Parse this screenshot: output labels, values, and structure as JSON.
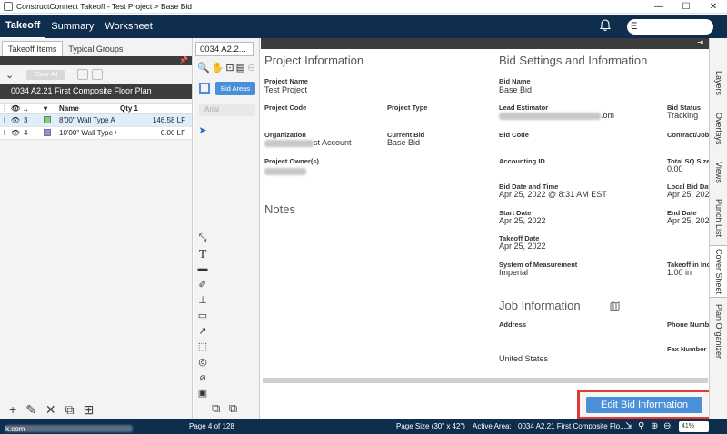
{
  "window": {
    "title": "ConstructConnect Takeoff - Test Project > Base Bid",
    "minimize": "—",
    "maximize": "☐",
    "close": "✕"
  },
  "menu": {
    "items": [
      "Takeoff",
      "Summary",
      "Worksheet"
    ],
    "user_initial": "E"
  },
  "left": {
    "tabs": [
      "Takeoff Items",
      "Typical Groups"
    ],
    "clear_all": "Clear All",
    "plan_name": "0034 A2.21 First Composite Floor Plan",
    "columns": {
      "num": "..",
      "name": "Name",
      "qty": "Qty 1"
    },
    "rows": [
      {
        "num": "3",
        "color": "#7fd36b",
        "name": "8'00\" Wall Type A",
        "qty": "146.58 LF"
      },
      {
        "num": "4",
        "color": "#8f8ff0",
        "name": "10'00\" Wall Type A",
        "qty": "0.00 LF"
      }
    ]
  },
  "mid": {
    "tab_label": "0034 A2.2...",
    "bid_areas": "Bid Areas",
    "font": "Arial"
  },
  "main": {
    "project_info_title": "Project Information",
    "bid_settings_title": "Bid Settings and Information",
    "notes_title": "Notes",
    "job_info_title": "Job Information",
    "project_name_label": "Project Name",
    "project_name": "Test Project",
    "project_code_label": "Project Code",
    "project_type_label": "Project Type",
    "organization_label": "Organization",
    "organization": "st Account",
    "current_bid_label": "Current Bid",
    "current_bid": "Base Bid",
    "owners_label": "Project Owner(s)",
    "bid_name_label": "Bid Name",
    "bid_name": "Base Bid",
    "lead_estimator_label": "Lead Estimator",
    "lead_estimator": ".om",
    "bid_status_label": "Bid Status",
    "bid_status": "Tracking",
    "bid_code_label": "Bid Code",
    "contract_label": "Contract/Job",
    "accounting_label": "Accounting ID",
    "total_sq_label": "Total SQ Size",
    "total_sq": "0.00",
    "bid_date_label": "Bid Date and Time",
    "bid_date": "Apr 25, 2022 @ 8:31 AM EST",
    "local_bid_label": "Local Bid Dat",
    "local_bid": "Apr 25, 2022",
    "start_date_label": "Start Date",
    "start_date": "Apr 25, 2022",
    "end_date_label": "End Date",
    "end_date": "Apr 25, 2022",
    "takeoff_date_label": "Takeoff Date",
    "takeoff_date": "Apr 25, 2022",
    "measure_label": "System of Measurement",
    "measure": "Imperial",
    "takeoff_inc_label": "Takeoff in Inc",
    "takeoff_inc": "1.00 in",
    "address_label": "Address",
    "phone_label": "Phone Number",
    "fax_label": "Fax Number",
    "country": "United States",
    "edit_button": "Edit Bid Information"
  },
  "right_tabs": [
    "Layers",
    "Overlays",
    "Views",
    "Punch List",
    "Cover Sheet",
    "Plan Organizer"
  ],
  "status": {
    "email_tail": "k.com",
    "page": "Page 4 of 128",
    "page_size": "Page Size (30\" x 42\")",
    "active_area_label": "Active Area:",
    "active_area": "0034 A2.21 First Composite Flo...",
    "zoom": "41%"
  },
  "colors": {
    "navy": "#0f2d4c",
    "accent": "#4a90d9",
    "highlight": "#e53935"
  }
}
